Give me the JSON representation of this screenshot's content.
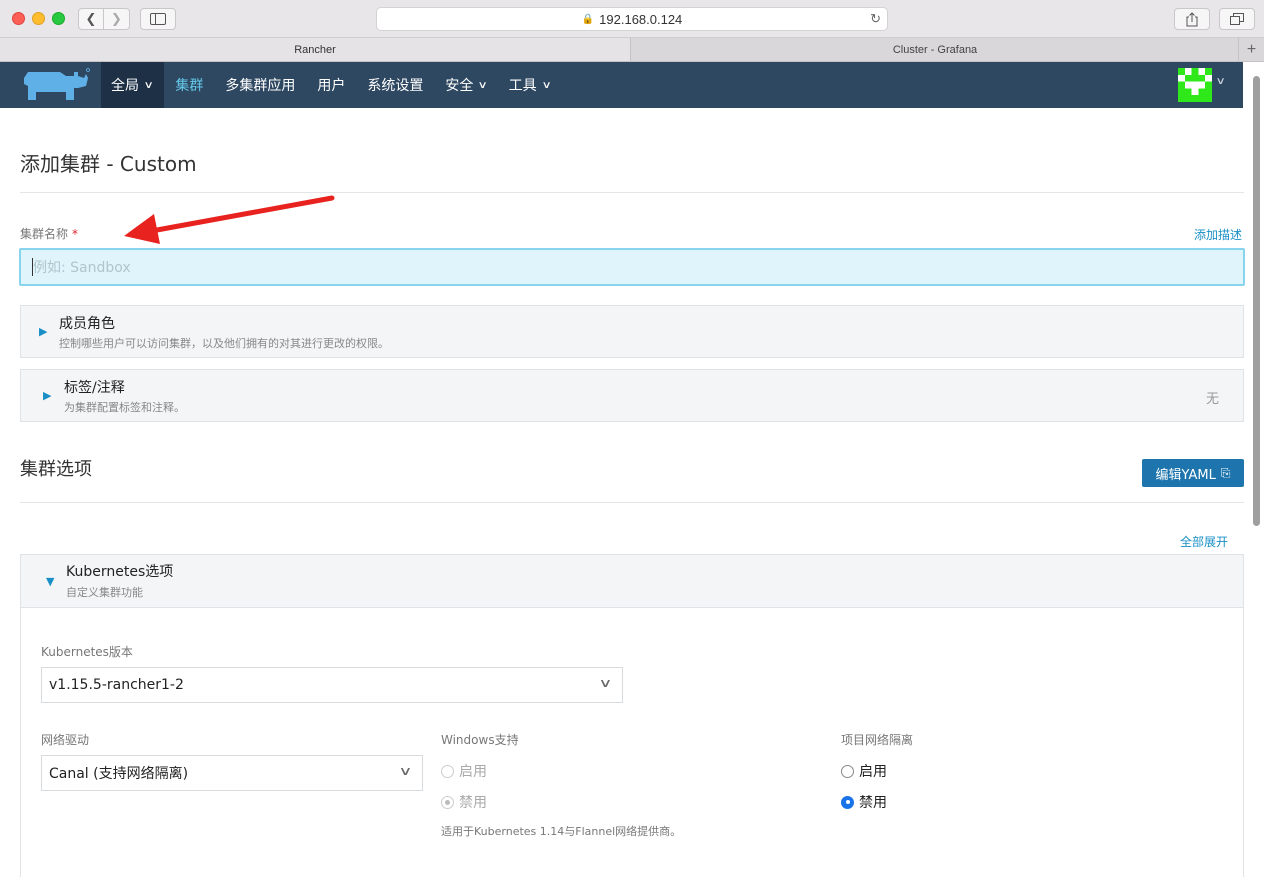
{
  "browser": {
    "url": "192.168.0.124",
    "tabs": [
      {
        "label": "Rancher"
      },
      {
        "label": "Cluster - Grafana"
      }
    ]
  },
  "nav": {
    "items": [
      {
        "label": "全局"
      },
      {
        "label": "集群"
      },
      {
        "label": "多集群应用"
      },
      {
        "label": "用户"
      },
      {
        "label": "系统设置"
      },
      {
        "label": "安全"
      },
      {
        "label": "工具"
      }
    ]
  },
  "page": {
    "title": "添加集群 - Custom",
    "cluster_name_label": "集群名称",
    "required_mark": "*",
    "add_description": "添加描述",
    "cluster_name_placeholder": "例如: Sandbox",
    "cluster_name_value": ""
  },
  "accordions": [
    {
      "title": "成员角色",
      "subtitle": "控制哪些用户可以访问集群，以及他们拥有的对其进行更改的权限。",
      "right": ""
    },
    {
      "title": "标签/注释",
      "subtitle": "为集群配置标签和注释。",
      "right": "无"
    }
  ],
  "cluster_options": {
    "title": "集群选项",
    "edit_yaml": "编辑YAML",
    "expand_all": "全部展开"
  },
  "k8s": {
    "title": "Kubernetes选项",
    "subtitle": "自定义集群功能",
    "version_label": "Kubernetes版本",
    "version_value": "v1.15.5-rancher1-2",
    "network_label": "网络驱动",
    "network_value": "Canal (支持网络隔离)",
    "windows_label": "Windows支持",
    "windows_options": [
      {
        "label": "启用",
        "selected": false,
        "disabled": true
      },
      {
        "label": "禁用",
        "selected": true,
        "disabled": true
      }
    ],
    "windows_note": "适用于Kubernetes 1.14与Flannel网络提供商。",
    "isolation_label": "项目网络隔离",
    "isolation_options": [
      {
        "label": "启用",
        "selected": false
      },
      {
        "label": "禁用",
        "selected": true
      }
    ]
  },
  "annotation_arrow_color": "#e8231f",
  "colors": {
    "header_bg": "#2f4862",
    "active_nav": "#64c8e8",
    "accent": "#1e75ad"
  }
}
